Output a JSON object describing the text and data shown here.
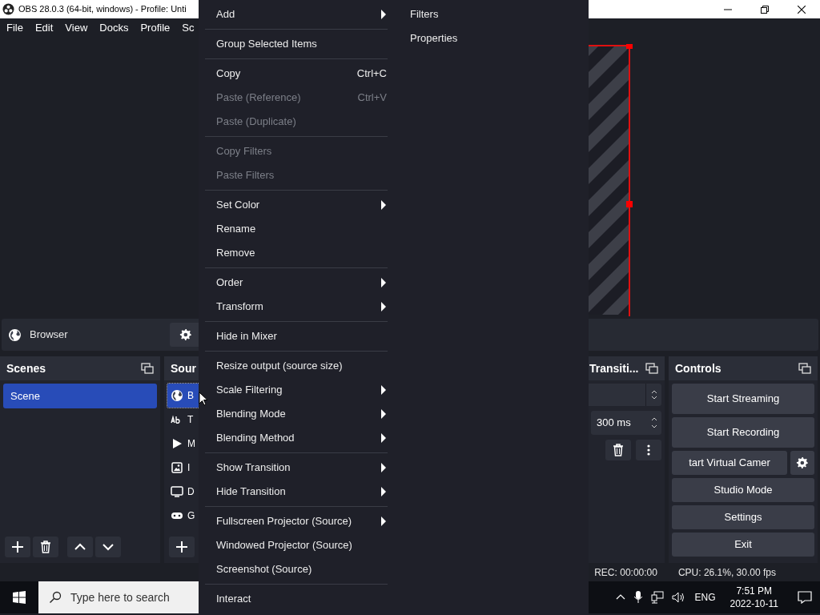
{
  "window": {
    "title": "OBS 28.0.3 (64-bit, windows) - Profile: Unti"
  },
  "menu_bar": [
    "File",
    "Edit",
    "View",
    "Docks",
    "Profile",
    "Sc"
  ],
  "source_toolbar": {
    "source_name": "Browser"
  },
  "scenes": {
    "title": "Scenes",
    "items": [
      {
        "label": "Scene",
        "selected": true
      }
    ]
  },
  "sources": {
    "title": "Sour",
    "items": [
      {
        "kind": "browser",
        "label": "B",
        "selected": true
      },
      {
        "kind": "text",
        "label": "T",
        "selected": false
      },
      {
        "kind": "media",
        "label": "M",
        "selected": false
      },
      {
        "kind": "image",
        "label": "I",
        "selected": false
      },
      {
        "kind": "display",
        "label": "D",
        "selected": false
      },
      {
        "kind": "game",
        "label": "G",
        "selected": false
      }
    ]
  },
  "transitions": {
    "title": "Transiti...",
    "duration": "300 ms"
  },
  "controls": {
    "title": "Controls",
    "buttons": [
      {
        "kind": "plain",
        "label": "Start Streaming"
      },
      {
        "kind": "plain",
        "label": "Start Recording"
      },
      {
        "kind": "split",
        "label": "tart Virtual Camer"
      },
      {
        "kind": "plain",
        "label": "Studio Mode"
      },
      {
        "kind": "plain",
        "label": "Settings"
      },
      {
        "kind": "plain",
        "label": "Exit"
      }
    ]
  },
  "status_bar": [
    "REC: 00:00:00",
    "CPU: 26.1%, 30.00 fps"
  ],
  "context_menu": {
    "items": [
      {
        "kind": "item",
        "label": "Add",
        "submenu": true,
        "disabled": false
      },
      {
        "kind": "separator"
      },
      {
        "kind": "item",
        "label": "Group Selected Items",
        "submenu": false,
        "disabled": false
      },
      {
        "kind": "separator"
      },
      {
        "kind": "item",
        "label": "Copy",
        "shortcut": "Ctrl+C",
        "submenu": false,
        "disabled": false
      },
      {
        "kind": "item",
        "label": "Paste (Reference)",
        "shortcut": "Ctrl+V",
        "submenu": false,
        "disabled": true
      },
      {
        "kind": "item",
        "label": "Paste (Duplicate)",
        "submenu": false,
        "disabled": true
      },
      {
        "kind": "separator"
      },
      {
        "kind": "item",
        "label": "Copy Filters",
        "submenu": false,
        "disabled": true
      },
      {
        "kind": "item",
        "label": "Paste Filters",
        "submenu": false,
        "disabled": true
      },
      {
        "kind": "separator"
      },
      {
        "kind": "item",
        "label": "Set Color",
        "submenu": true,
        "disabled": false
      },
      {
        "kind": "item",
        "label": "Rename",
        "submenu": false,
        "disabled": false
      },
      {
        "kind": "item",
        "label": "Remove",
        "submenu": false,
        "disabled": false
      },
      {
        "kind": "separator"
      },
      {
        "kind": "item",
        "label": "Order",
        "submenu": true,
        "disabled": false
      },
      {
        "kind": "item",
        "label": "Transform",
        "submenu": true,
        "disabled": false
      },
      {
        "kind": "separator"
      },
      {
        "kind": "item",
        "label": "Hide in Mixer",
        "submenu": false,
        "disabled": false
      },
      {
        "kind": "separator"
      },
      {
        "kind": "item",
        "label": "Resize output (source size)",
        "submenu": false,
        "disabled": false
      },
      {
        "kind": "item",
        "label": "Scale Filtering",
        "submenu": true,
        "disabled": false
      },
      {
        "kind": "item",
        "label": "Blending Mode",
        "submenu": true,
        "disabled": false
      },
      {
        "kind": "item",
        "label": "Blending Method",
        "submenu": true,
        "disabled": false
      },
      {
        "kind": "separator"
      },
      {
        "kind": "item",
        "label": "Show Transition",
        "submenu": true,
        "disabled": false
      },
      {
        "kind": "item",
        "label": "Hide Transition",
        "submenu": true,
        "disabled": false
      },
      {
        "kind": "separator"
      },
      {
        "kind": "item",
        "label": "Fullscreen Projector (Source)",
        "submenu": true,
        "disabled": false
      },
      {
        "kind": "item",
        "label": "Windowed Projector (Source)",
        "submenu": false,
        "disabled": false
      },
      {
        "kind": "item",
        "label": "Screenshot (Source)",
        "submenu": false,
        "disabled": false
      },
      {
        "kind": "separator"
      },
      {
        "kind": "item",
        "label": "Interact",
        "submenu": false,
        "disabled": false
      }
    ],
    "side_items": [
      "Filters",
      "Properties"
    ]
  },
  "taskbar": {
    "search_placeholder": "Type here to search",
    "language": "ENG",
    "time": "7:51 PM",
    "date": "2022-10-11"
  }
}
